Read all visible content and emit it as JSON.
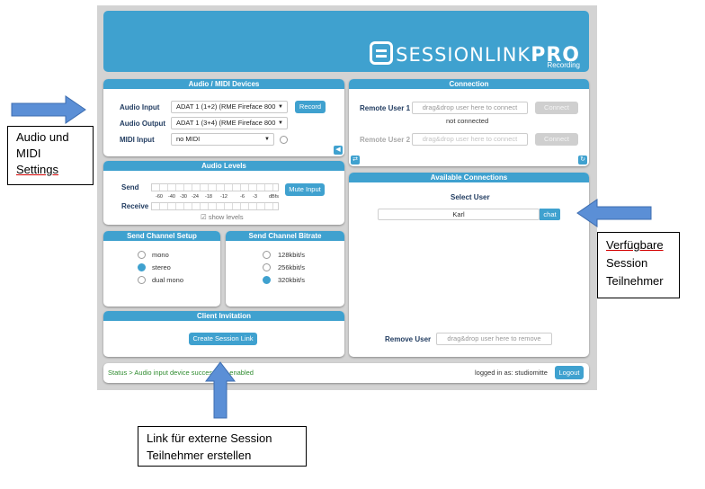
{
  "header": {
    "logo_main": "SESSIONLINK",
    "logo_pro": "PRO",
    "logo_sub": "Recording"
  },
  "audio_midi": {
    "title": "Audio / MIDI Devices",
    "audio_input_label": "Audio Input",
    "audio_input_value": "ADAT 1 (1+2) (RME Fireface 800",
    "record_label": "Record",
    "audio_output_label": "Audio Output",
    "audio_output_value": "ADAT 1 (3+4) (RME Fireface 800",
    "midi_input_label": "MIDI Input",
    "midi_input_value": "no MIDI"
  },
  "audio_levels": {
    "title": "Audio Levels",
    "send_label": "Send",
    "receive_label": "Receive",
    "scale": [
      "-60",
      "-40",
      "-30",
      "-24",
      "-18",
      "-12",
      "-6",
      "-3",
      "dBfs"
    ],
    "mute_label": "Mute Input",
    "show_levels_label": "show levels"
  },
  "send_channel": {
    "title": "Send Channel Setup",
    "options": [
      "mono",
      "stereo",
      "dual mono"
    ],
    "selected": 1
  },
  "bitrate": {
    "title": "Send Channel Bitrate",
    "options": [
      "128kbit/s",
      "256kbit/s",
      "320kbit/s"
    ],
    "selected": 2
  },
  "client_invitation": {
    "title": "Client Invitation",
    "button_label": "Create Session Link"
  },
  "connection": {
    "title": "Connection",
    "remote1_label": "Remote User 1",
    "remote1_placeholder": "drag&drop user here to connect",
    "remote1_status": "not connected",
    "remote2_label": "Remote User 2",
    "remote2_placeholder": "drag&drop user here to connect",
    "connect_label": "Connect"
  },
  "available": {
    "title": "Available Connections",
    "select_user_label": "Select User",
    "user": "Karl",
    "chat_label": "chat",
    "remove_user_label": "Remove User",
    "remove_placeholder": "drag&drop user here to remove"
  },
  "status": {
    "text": "Status > Audio input device successfully enabled",
    "logged_in": "logged in as: studiomitte",
    "logout_label": "Logout"
  },
  "annotations": {
    "audio_midi_line1": "Audio und",
    "audio_midi_line2": "MIDI",
    "audio_midi_line3": "Settings",
    "session_line1": "Verfügbare",
    "session_line2": "Session",
    "session_line3": "Teilnehmer",
    "link_line1": "Link für externe Session",
    "link_line2": "Teilnehmer erstellen"
  },
  "colors": {
    "accent": "#3fa1cf",
    "status_text": "#2e8b2e",
    "arrow": "#5b8fd6"
  }
}
